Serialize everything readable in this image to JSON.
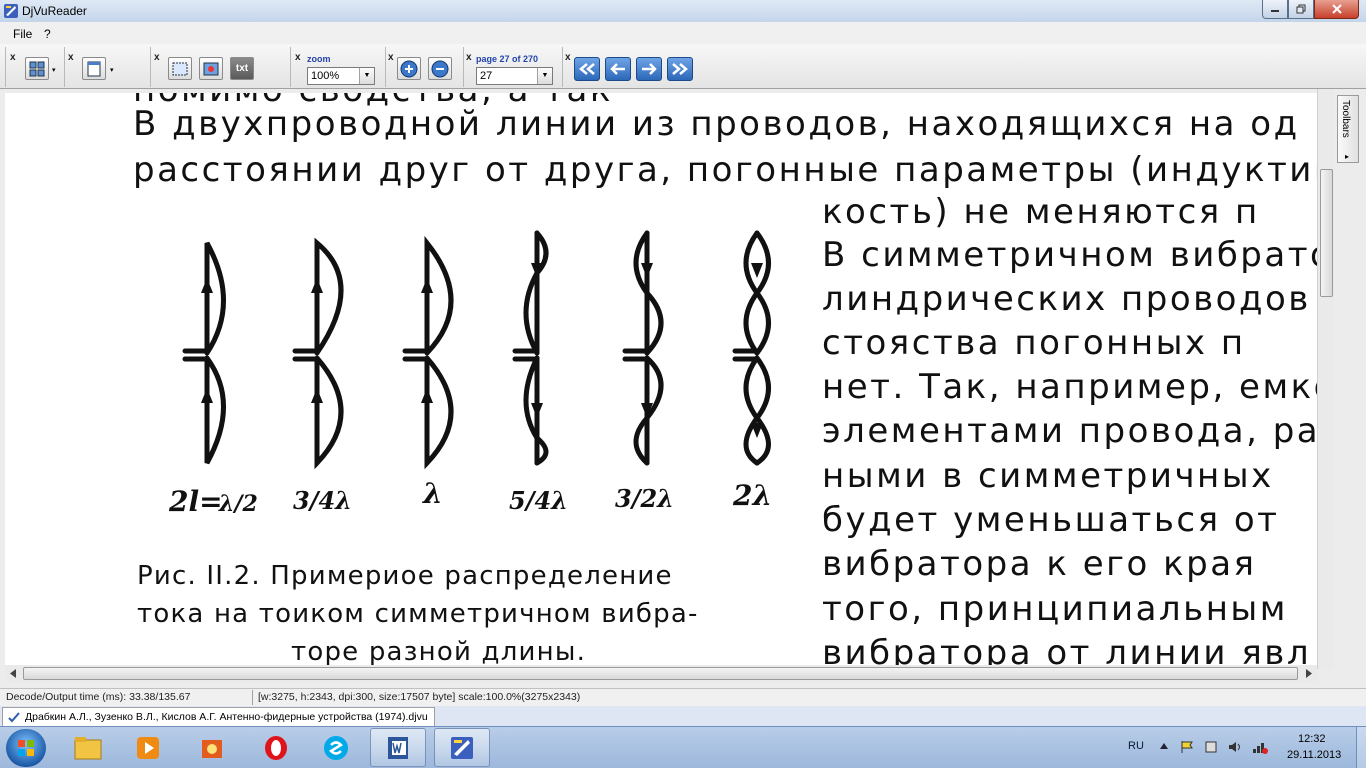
{
  "window": {
    "title": "DjVuReader"
  },
  "menu": {
    "file": "File",
    "help": "?"
  },
  "toolbar": {
    "zoom_label": "zoom",
    "zoom_value": "100%",
    "page_label": "page 27 of 270",
    "page_value": "27",
    "txt_label": "txt",
    "toolbars_tab": "Toolbars",
    "toolbars_arrow": "▸",
    "close_glyph": "x",
    "combo_arrow": "▼",
    "drop_arrow": "▾"
  },
  "document": {
    "lines": [
      "помимо сводства, а так",
      "В двухпроводной линии из проводов, находящихся на од",
      "расстоянии друг от друга,  погонные параметры (индуктив",
      "кость)  не  меняются  п",
      "В симметричном вибрато",
      "линдрических проводов т",
      "стояства  погонных  п",
      "нет. Так, например, емко",
      "элементами провода, ра",
      "ными  в  симметричных",
      "будет  уменьшаться  от",
      "вибратора  к  его  края",
      "того,  принципиальным",
      "вибратора от линии  явл"
    ],
    "figure_labels": [
      "2l=",
      "λ/2",
      "3/4λ",
      "λ",
      "5/4λ",
      "3/2λ",
      "2λ"
    ],
    "caption": [
      "Рис.  II.2. Примериое  распределение",
      "тока на тоиком симметричном вибра-",
      "торе разной длины."
    ]
  },
  "status": {
    "decode_time": "Decode/Output time (ms): 33.38/135.67",
    "image_info": "[w:3275, h:2343, dpi:300, size:17507 byte] scale:100.0%(3275x2343)",
    "doc_tab": "Драбкин А.Л., Зузенко В.Л., Кислов А.Г. Антенно-фидерные устройства (1974).djvu"
  },
  "taskbar": {
    "apps": [
      "explorer",
      "media-player",
      "app-3",
      "opera",
      "skype",
      "word",
      "djvureader"
    ],
    "lang": "RU",
    "time": "12:32",
    "date": "29.11.2013"
  },
  "colors": {
    "nav_button": "#2c68b8",
    "title_gradient": "#c4d5ea",
    "close_button": "#c7402b"
  }
}
